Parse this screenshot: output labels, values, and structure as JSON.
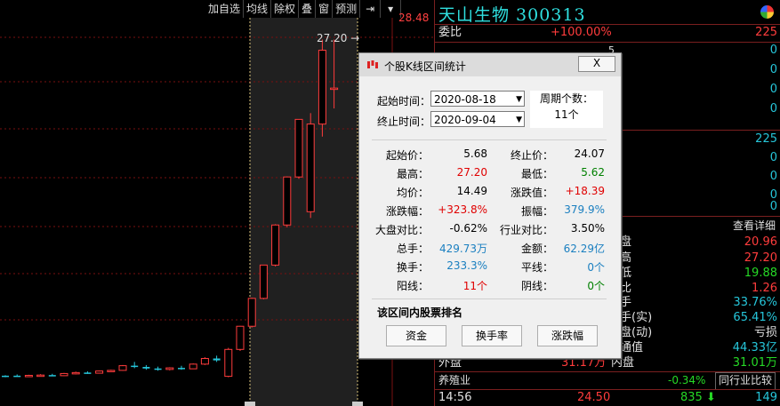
{
  "toolbar": {
    "buttons": [
      "加自选",
      "均线",
      "除权",
      "叠",
      "窗",
      "预测"
    ]
  },
  "chart": {
    "price_label_top": "28.48",
    "peak_label": "27.20"
  },
  "stock": {
    "title": "天山生物 300313",
    "weibi_label": "委比",
    "weibi_value": "+100.00%",
    "weibi_count": "225",
    "order_values": [
      "5",
      "0",
      "0",
      "0",
      "0",
      "225",
      "0",
      "0",
      "0",
      "0"
    ],
    "detail_link": "查看详细",
    "stats": [
      {
        "label": "盘",
        "value": "20.96"
      },
      {
        "label": "高",
        "value": "27.20"
      },
      {
        "label": "低",
        "value": "19.88"
      },
      {
        "label": "比",
        "value": "1.26"
      },
      {
        "label": "手",
        "value": "33.76%"
      },
      {
        "label": "手(实)",
        "value": "65.41%"
      },
      {
        "label": "盘(动)",
        "value": "亏损"
      },
      {
        "label": "通值",
        "value": "44.33亿"
      }
    ],
    "waipan_label": "外盘",
    "waipan_value": "31.17万",
    "neipan_label": "内盘",
    "neipan_value": "31.01万",
    "industry_label": "养殖业",
    "industry_change": "-0.34%",
    "industry_compare": "同行业比较",
    "tick_time": "14:56",
    "tick_price": "24.50",
    "tick_volume": "835",
    "tick_extra": "149"
  },
  "dialog": {
    "title": "个股K线区间统计",
    "close_label": "X",
    "start_label": "起始时间：",
    "start_value": "2020-08-18",
    "end_label": "终止时间：",
    "end_value": "2020-09-04",
    "period_label": "周期个数：",
    "period_value": "11个",
    "stats": [
      {
        "k1": "起始价：",
        "v1": "5.68",
        "c1": "d-blk",
        "k2": "终止价：",
        "v2": "24.07",
        "c2": "d-blk"
      },
      {
        "k1": "最高：",
        "v1": "27.20",
        "c1": "d-red",
        "k2": "最低：",
        "v2": "5.62",
        "c2": "d-grn"
      },
      {
        "k1": "均价：",
        "v1": "14.49",
        "c1": "d-blk",
        "k2": "涨跌值：",
        "v2": "+18.39",
        "c2": "d-red"
      },
      {
        "k1": "涨跌幅：",
        "v1": "+323.8%",
        "c1": "d-red",
        "k2": "振幅：",
        "v2": "379.9%",
        "c2": "d-blu"
      },
      {
        "k1": "大盘对比：",
        "v1": "-0.62%",
        "c1": "d-blk",
        "k2": "行业对比：",
        "v2": "3.50%",
        "c2": "d-blk"
      },
      {
        "k1": "总手：",
        "v1": "429.73万",
        "c1": "d-blu",
        "k2": "金额：",
        "v2": "62.29亿",
        "c2": "d-blu"
      },
      {
        "k1": "换手：",
        "v1": "233.3%",
        "c1": "d-blu",
        "k2": "平线：",
        "v2": "0个",
        "c2": "d-blu"
      },
      {
        "k1": "阳线：",
        "v1": "11个",
        "c1": "d-red",
        "k2": "阴线：",
        "v2": "0个",
        "c2": "d-grn"
      }
    ],
    "rank_title": "该区间内股票排名",
    "rank_buttons": [
      "资金",
      "换手率",
      "涨跌幅"
    ]
  },
  "candles": [
    {
      "o": 5.68,
      "h": 5.75,
      "l": 5.62,
      "c": 5.72,
      "color": "#26c6da"
    },
    {
      "o": 5.72,
      "h": 5.8,
      "l": 5.66,
      "c": 5.7,
      "color": "#26c6da"
    },
    {
      "o": 5.7,
      "h": 5.78,
      "l": 5.64,
      "c": 5.74,
      "color": "#ff3c3c"
    },
    {
      "o": 5.74,
      "h": 5.82,
      "l": 5.68,
      "c": 5.76,
      "color": "#ff3c3c"
    },
    {
      "o": 5.76,
      "h": 5.84,
      "l": 5.7,
      "c": 5.72,
      "color": "#26c6da"
    },
    {
      "o": 5.72,
      "h": 5.9,
      "l": 5.7,
      "c": 5.86,
      "color": "#ff3c3c"
    },
    {
      "o": 5.86,
      "h": 5.98,
      "l": 5.8,
      "c": 5.92,
      "color": "#ff3c3c"
    },
    {
      "o": 5.92,
      "h": 6.0,
      "l": 5.84,
      "c": 5.88,
      "color": "#26c6da"
    },
    {
      "o": 5.88,
      "h": 6.05,
      "l": 5.86,
      "c": 6.02,
      "color": "#ff3c3c"
    },
    {
      "o": 6.02,
      "h": 6.1,
      "l": 5.96,
      "c": 6.06,
      "color": "#ff3c3c"
    },
    {
      "o": 6.06,
      "h": 6.4,
      "l": 6.04,
      "c": 6.36,
      "color": "#ff3c3c"
    },
    {
      "o": 6.36,
      "h": 6.6,
      "l": 6.2,
      "c": 6.28,
      "color": "#26c6da"
    },
    {
      "o": 6.28,
      "h": 6.4,
      "l": 6.1,
      "c": 6.18,
      "color": "#26c6da"
    },
    {
      "o": 6.18,
      "h": 6.3,
      "l": 6.04,
      "c": 6.12,
      "color": "#26c6da"
    },
    {
      "o": 6.12,
      "h": 6.26,
      "l": 6.06,
      "c": 6.22,
      "color": "#ff3c3c"
    },
    {
      "o": 6.22,
      "h": 6.35,
      "l": 6.1,
      "c": 6.16,
      "color": "#26c6da"
    },
    {
      "o": 6.16,
      "h": 6.5,
      "l": 6.14,
      "c": 6.46,
      "color": "#ff3c3c"
    },
    {
      "o": 6.46,
      "h": 6.9,
      "l": 6.4,
      "c": 6.82,
      "color": "#ff3c3c"
    },
    {
      "o": 6.82,
      "h": 7.0,
      "l": 6.6,
      "c": 6.7,
      "color": "#26c6da"
    },
    {
      "o": 5.68,
      "h": 7.5,
      "l": 5.62,
      "c": 7.4,
      "color": "#ff3c3c"
    },
    {
      "o": 7.4,
      "h": 8.9,
      "l": 7.3,
      "c": 8.88,
      "color": "#ff3c3c"
    },
    {
      "o": 8.88,
      "h": 10.7,
      "l": 8.8,
      "c": 10.66,
      "color": "#ff3c3c"
    },
    {
      "o": 10.66,
      "h": 12.8,
      "l": 10.6,
      "c": 12.79,
      "color": "#ff3c3c"
    },
    {
      "o": 12.79,
      "h": 15.4,
      "l": 12.7,
      "c": 15.35,
      "color": "#ff3c3c"
    },
    {
      "o": 15.35,
      "h": 18.45,
      "l": 15.2,
      "c": 18.42,
      "color": "#ff3c3c"
    },
    {
      "o": 18.42,
      "h": 22.1,
      "l": 18.3,
      "c": 22.1,
      "color": "#ff3c3c"
    },
    {
      "o": 16.2,
      "h": 22.5,
      "l": 15.8,
      "c": 21.8,
      "color": "#ff3c3c"
    },
    {
      "o": 21.8,
      "h": 27.2,
      "l": 21.0,
      "c": 26.52,
      "color": "#ff3c3c"
    },
    {
      "o": 24.1,
      "h": 27.2,
      "l": 22.8,
      "c": 24.07,
      "color": "#ff3c3c"
    }
  ]
}
